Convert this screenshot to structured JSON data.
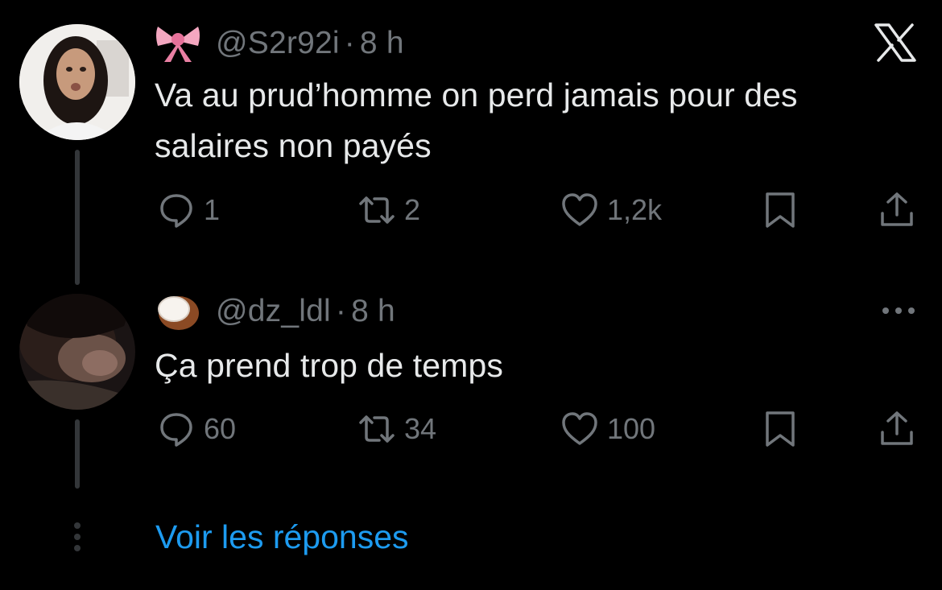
{
  "tweets": [
    {
      "handle": "@S2r92i",
      "time_sep": "·",
      "time": "8 h",
      "emoji": "ribbon-emoji",
      "lines": [
        "Va au prud’homme on perd jamais pour des",
        "salaires non payés"
      ],
      "replies": "1",
      "retweets": "2",
      "likes": "1,2k",
      "top_right_icon": "x-logo-icon"
    },
    {
      "handle": "@dz_ldl",
      "time_sep": "·",
      "time": "8 h",
      "emoji": "coconut-emoji",
      "lines": [
        "Ça prend trop de temps"
      ],
      "replies": "60",
      "retweets": "34",
      "likes": "100",
      "top_right_icon": "more-icon"
    }
  ],
  "thread": {
    "show_replies_label": "Voir les réponses"
  },
  "colors": {
    "background": "#000000",
    "text": "#e7e9ea",
    "muted": "#71767b",
    "link": "#1d9bf0",
    "thread_line": "#333639"
  }
}
